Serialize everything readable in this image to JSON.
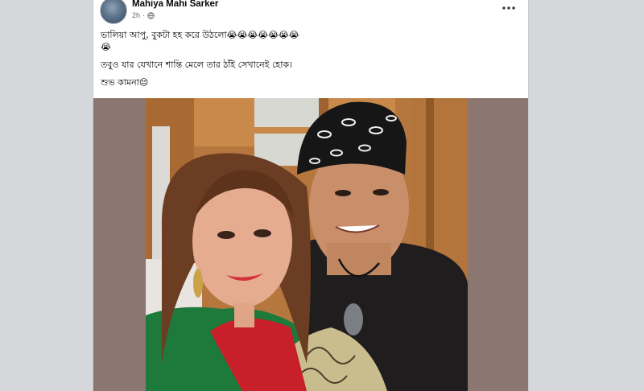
{
  "post": {
    "author": "Mahiya Mahi Sarker",
    "time": "2h",
    "separator": "·",
    "text_lines": [
      "ভালিয়া আপু, বুকটা হহ করে উঠলো😭😭😭😭😭😭😭\n😭",
      "তবুও যার যেখানে শান্তি মেলে তার ঠাঁই সেখানেই হোক।",
      "শুভ কামনা😔"
    ]
  },
  "icons": {
    "avatar": "profile-avatar",
    "privacy": "globe-icon",
    "more": "more-options-icon"
  },
  "colors": {
    "page_background": "#d6d7db",
    "card_background": "#ffffff",
    "photo_frame": "#8b7770",
    "author_text": "#050505",
    "meta_text": "#65676b"
  }
}
